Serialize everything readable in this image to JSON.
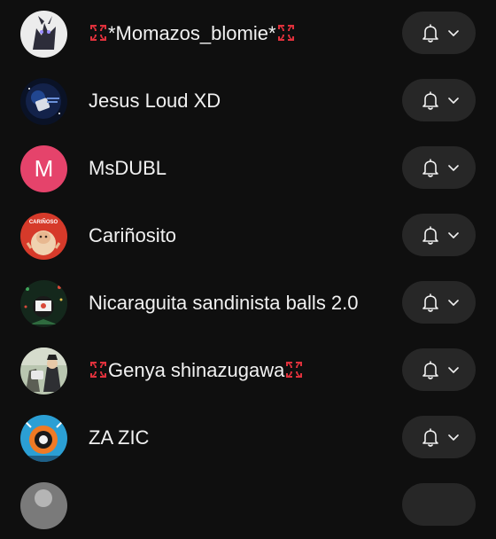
{
  "subscriptions": [
    {
      "name": "*Momazos_blomie*",
      "avatar_letter": "",
      "anger_marks": true
    },
    {
      "name": "Jesus Loud XD",
      "avatar_letter": "",
      "anger_marks": false
    },
    {
      "name": "MsDUBL",
      "avatar_letter": "M",
      "anger_marks": false
    },
    {
      "name": "Cariñosito",
      "avatar_letter": "",
      "avatar_caption": "CARIÑOSO",
      "anger_marks": false
    },
    {
      "name": "Nicaraguita sandinista balls 2.0",
      "avatar_letter": "",
      "anger_marks": false
    },
    {
      "name": "Genya shinazugawa",
      "avatar_letter": "",
      "anger_marks": true
    },
    {
      "name": "ZA ZIC",
      "avatar_letter": "",
      "anger_marks": false
    }
  ],
  "icons": {
    "notification": "bell-icon",
    "dropdown": "chevron-down-icon",
    "anger": "anger-symbol-icon"
  },
  "colors": {
    "background": "#0f0f0f",
    "button_background": "#272727",
    "text": "#f1f1f1",
    "msdubl_avatar": "#e5436b",
    "anger_symbol": "#e0313c"
  }
}
